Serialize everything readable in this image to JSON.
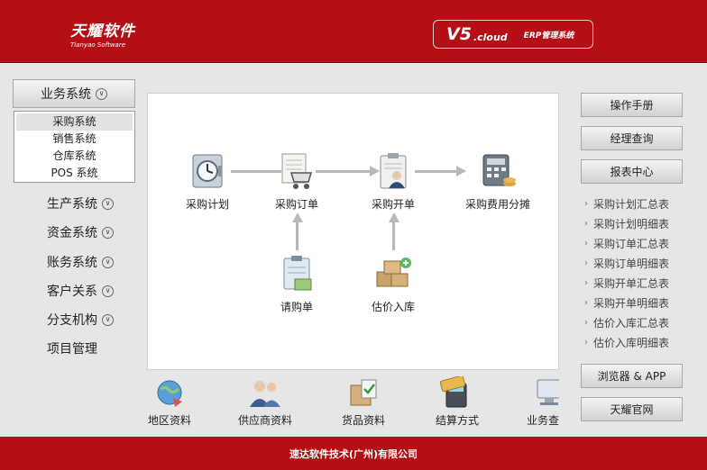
{
  "header": {
    "logo_cn": "天耀软件",
    "logo_en": "Tianyao Software",
    "version": "V5",
    "version_suffix": ".cloud",
    "erp_title": "ERP管理系统"
  },
  "left_menu": {
    "business_label": "业务系统",
    "submenu": [
      "采购系统",
      "销售系统",
      "仓库系统",
      "POS 系统"
    ],
    "items": [
      {
        "label": "生产系统",
        "has_chevron": true
      },
      {
        "label": "资金系统",
        "has_chevron": true
      },
      {
        "label": "账务系统",
        "has_chevron": true
      },
      {
        "label": "客户关系",
        "has_chevron": true
      },
      {
        "label": "分支机构",
        "has_chevron": true
      },
      {
        "label": "项目管理",
        "has_chevron": false
      }
    ]
  },
  "flow": {
    "plan": "采购计划",
    "order": "采购订单",
    "invoice": "采购开单",
    "cost_allocation": "采购费用分摊",
    "requisition": "请购单",
    "estimate_in": "估价入库"
  },
  "bottom_icons": [
    "地区资料",
    "供应商资料",
    "货品资料",
    "结算方式",
    "业务查"
  ],
  "right_panel": {
    "manual": "操作手册",
    "manager_query": "经理查询",
    "report_center": "报表中心",
    "reports": [
      "采购计划汇总表",
      "采购计划明细表",
      "采购订单汇总表",
      "采购订单明细表",
      "采购开单汇总表",
      "采购开单明细表",
      "估价入库汇总表",
      "估价入库明细表"
    ],
    "browser_app": "浏览器 & APP",
    "official_site": "天耀官网"
  },
  "footer": {
    "company": "速达软件技术(广州)有限公司"
  },
  "colors": {
    "brand_red": "#b30f14",
    "background": "#e6e6e6"
  }
}
